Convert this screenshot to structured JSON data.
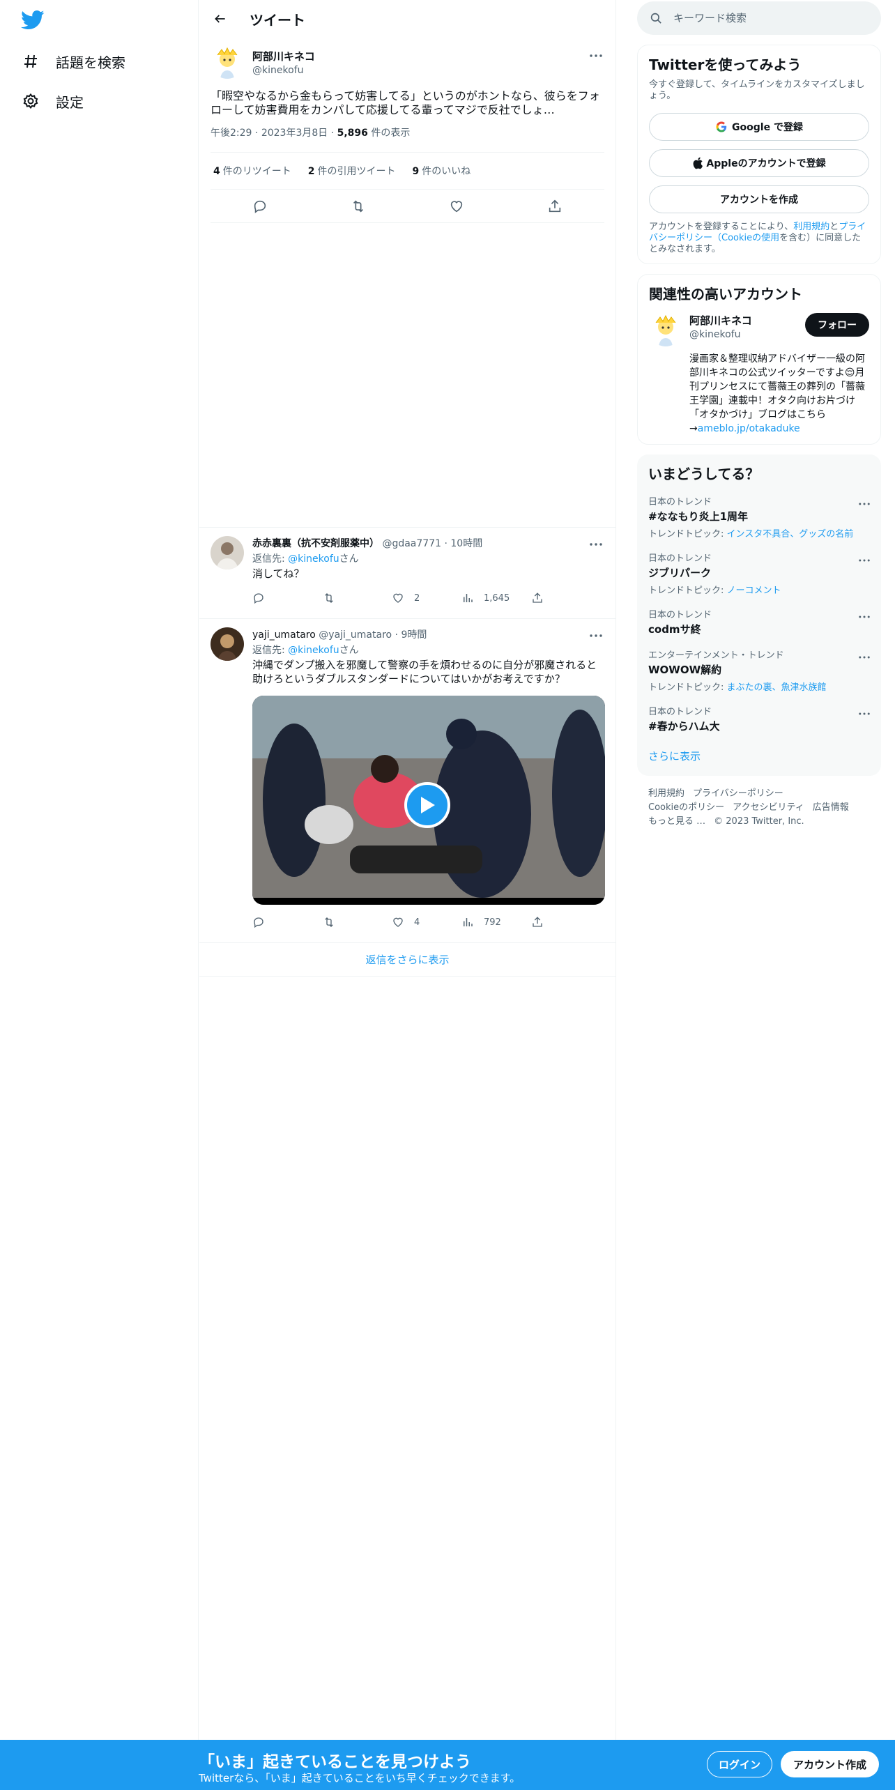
{
  "sidebar": {
    "logo": "twitter-bird-icon",
    "items": [
      {
        "label": "話題を検索",
        "icon": "hashtag-icon"
      },
      {
        "label": "設定",
        "icon": "gear-icon"
      }
    ]
  },
  "header": {
    "title": "ツイート"
  },
  "main_tweet": {
    "name": "阿部川キネコ",
    "handle": "@kinekofu",
    "text": "「暇空やなるから金もらって妨害してる」というのがホントなら、彼らをフォローして妨害費用をカンパして応援してる輩ってマジで反社でしょ…",
    "time": "午後2:29",
    "date": "2023年3月8日",
    "views_count": "5,896",
    "views_label": "件の表示",
    "retweets_count": "4",
    "retweets_label": "件のリツイート",
    "quotes_count": "2",
    "quotes_label": "件の引用ツイート",
    "likes_count": "9",
    "likes_label": "件のいいね"
  },
  "replies": [
    {
      "name": "赤赤裏裏（抗不安剤服薬中）",
      "handle": "@gdaa7771",
      "time": "10時間",
      "reply_to_prefix": "返信先: ",
      "reply_to": "@kinekofu",
      "reply_to_suffix": "さん",
      "text": "消してね？",
      "likes": "2",
      "views": "1,645"
    },
    {
      "name": "yaji_umataro",
      "handle": "@yaji_umataro",
      "time": "9時間",
      "reply_to_prefix": "返信先: ",
      "reply_to": "@kinekofu",
      "reply_to_suffix": "さん",
      "text": "沖縄でダンプ搬入を邪魔して警察の手を煩わせるのに自分が邪魔されると助けろというダブルスタンダードについてはいかがお考えですか？",
      "likes": "4",
      "views": "792"
    }
  ],
  "show_more_replies": "返信をさらに表示",
  "search": {
    "placeholder": "キーワード検索"
  },
  "signup_card": {
    "title": "Twitterを使ってみよう",
    "subtitle": "今すぐ登録して、タイムラインをカスタマイズしましょう。",
    "google": "Google で登録",
    "apple": "Appleのアカウントで登録",
    "create": "アカウントを作成",
    "terms_1": "アカウントを登録することにより、",
    "terms_link_1": "利用規約",
    "terms_2": "と",
    "terms_link_2": "プライバシーポリシー（Cookieの使用",
    "terms_3": "を含む）に同意したとみなされます。"
  },
  "related": {
    "title": "関連性の高いアカウント",
    "name": "阿部川キネコ",
    "handle": "@kinekofu",
    "follow": "フォロー",
    "bio": "漫画家＆整理収納アドバイザー一級の阿部川キネコの公式ツイッターですよ😌月刊プリンセスにて薔薇王の葬列の「薔薇王学園」連載中！オタク向けお片づけ「オタかづけ」ブログはこちら→",
    "bio_link": "ameblo.jp/otakaduke"
  },
  "trends": {
    "title": "いまどうしてる？",
    "items": [
      {
        "category": "日本のトレンド",
        "name": "#ななもり炎上1周年",
        "topic_label": "トレンドトピック: ",
        "topic": "インスタ不具合、グッズの名前"
      },
      {
        "category": "日本のトレンド",
        "name": "ジブリパーク",
        "topic_label": "トレンドトピック: ",
        "topic": "ノーコメント"
      },
      {
        "category": "日本のトレンド",
        "name": "codmサ終",
        "topic_label": "",
        "topic": ""
      },
      {
        "category": "エンターテインメント・トレンド",
        "name": "WOWOW解約",
        "topic_label": "トレンドトピック: ",
        "topic": "まぶたの裏、魚津水族館"
      },
      {
        "category": "日本のトレンド",
        "name": "#春からハム大",
        "topic_label": "",
        "topic": ""
      }
    ],
    "show_more": "さらに表示"
  },
  "footer": {
    "links": [
      "利用規約",
      "プライバシーポリシー",
      "Cookieのポリシー",
      "アクセシビリティ",
      "広告情報",
      "もっと見る …"
    ],
    "copyright": "© 2023 Twitter, Inc."
  },
  "bottom_bar": {
    "title": "「いま」起きていることを見つけよう",
    "subtitle": "Twitterなら、「いま」起きていることをいち早くチェックできます。",
    "login": "ログイン",
    "signup": "アカウント作成"
  },
  "colors": {
    "accent": "#1d9bf0",
    "text": "#0f1419",
    "muted": "#536471",
    "border": "#eff3f4"
  }
}
